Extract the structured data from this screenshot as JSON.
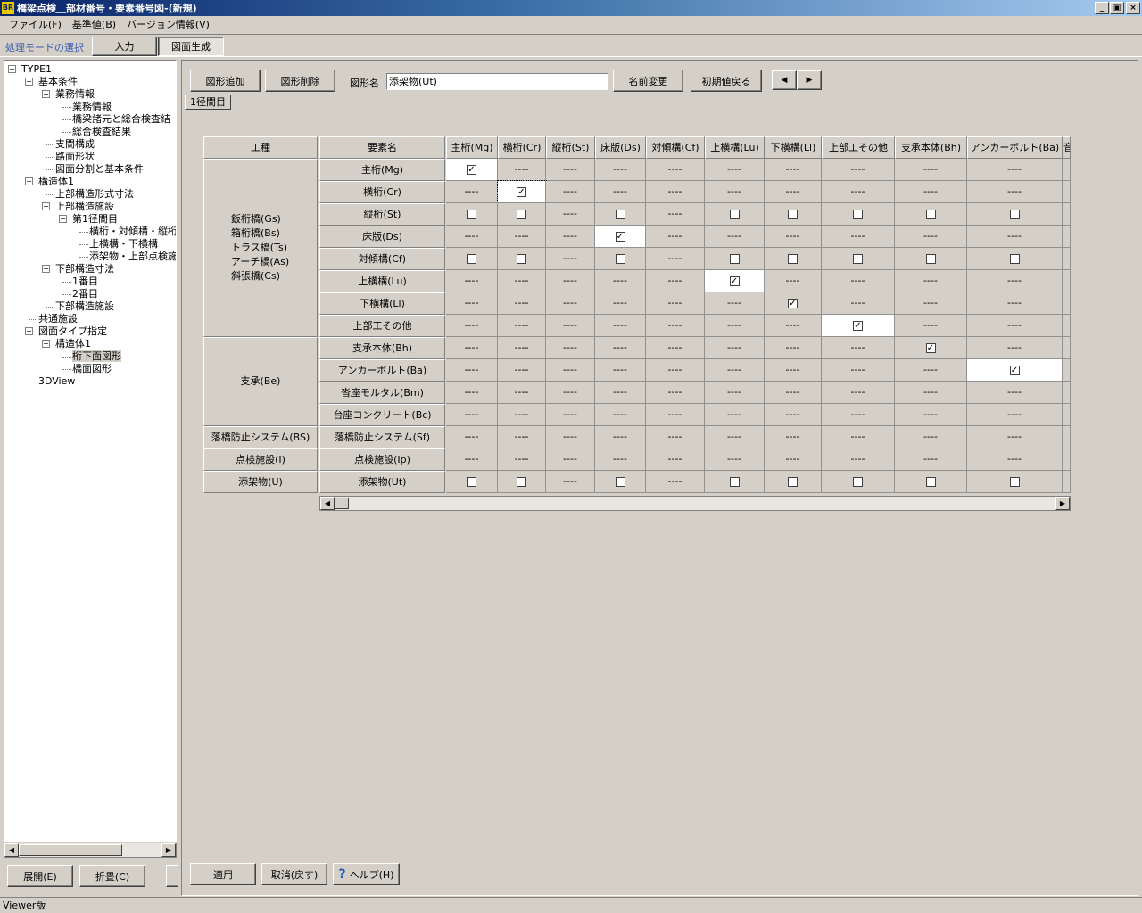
{
  "window": {
    "app_icon": "BR",
    "title": "橋梁点検＿部材番号・要素番号図-(新規)",
    "minimize": "_",
    "maximize": "▣",
    "close": "×"
  },
  "menu": [
    "ファイル(F)",
    "基準値(B)",
    "バージョン情報(V)"
  ],
  "mode": {
    "label": "処理モードの選択",
    "input_label": "入力",
    "generate_label": "図面生成",
    "active": "generate"
  },
  "tree": {
    "items": [
      {
        "label": "TYPE1",
        "level": 0,
        "box": "-"
      },
      {
        "label": "基本条件",
        "level": 1,
        "box": "-"
      },
      {
        "label": "業務情報",
        "level": 2,
        "box": "-"
      },
      {
        "label": "業務情報",
        "level": 3,
        "box": ""
      },
      {
        "label": "橋梁諸元と総合検査結",
        "level": 3,
        "box": ""
      },
      {
        "label": "総合検査結果",
        "level": 3,
        "box": ""
      },
      {
        "label": "支間構成",
        "level": 2,
        "box": ""
      },
      {
        "label": "路面形状",
        "level": 2,
        "box": ""
      },
      {
        "label": "図面分割と基本条件",
        "level": 2,
        "box": ""
      },
      {
        "label": "構造体1",
        "level": 1,
        "box": "-"
      },
      {
        "label": "上部構造形式寸法",
        "level": 2,
        "box": ""
      },
      {
        "label": "上部構造施設",
        "level": 2,
        "box": "-"
      },
      {
        "label": "第1径間目",
        "level": 3,
        "box": "-"
      },
      {
        "label": "横桁・対傾構・縦桁",
        "level": 4,
        "box": ""
      },
      {
        "label": "上横構・下横構",
        "level": 4,
        "box": ""
      },
      {
        "label": "添架物・上部点検施",
        "level": 4,
        "box": ""
      },
      {
        "label": "下部構造寸法",
        "level": 2,
        "box": "-"
      },
      {
        "label": "1番目",
        "level": 3,
        "box": ""
      },
      {
        "label": "2番目",
        "level": 3,
        "box": ""
      },
      {
        "label": "下部構造施設",
        "level": 2,
        "box": ""
      },
      {
        "label": "共通施設",
        "level": 1,
        "box": ""
      },
      {
        "label": "図面タイプ指定",
        "level": 1,
        "box": "-"
      },
      {
        "label": "構造体1",
        "level": 2,
        "box": "-"
      },
      {
        "label": "桁下面図形",
        "level": 3,
        "box": "",
        "selected": true
      },
      {
        "label": "橋面図形",
        "level": 3,
        "box": ""
      },
      {
        "label": "3DView",
        "level": 1,
        "box": ""
      }
    ],
    "expand_label": "展開(E)",
    "collapse_label": "折畳(C)"
  },
  "toolbar": {
    "add_label": "図形追加",
    "delete_label": "図形削除",
    "name_caption": "図形名",
    "name_value": "添架物(Ut)",
    "rename_label": "名前変更",
    "reset_label": "初期値戻る",
    "prev": "◀",
    "next": "▶",
    "span_label": "1径間目"
  },
  "grid": {
    "type_header": "工種",
    "elem_header": "要素名",
    "columns": [
      "主桁(Mg)",
      "横桁(Cr)",
      "縦桁(St)",
      "床版(Ds)",
      "対傾構(Cf)",
      "上横構(Lu)",
      "下横構(Ll)",
      "上部工その他",
      "支承本体(Bh)",
      "アンカーボルト(Ba)",
      "音"
    ],
    "type_groups": [
      {
        "lines": [
          "鈑桁橋(Gs)",
          "箱桁橋(Bs)",
          "トラス橋(Ts)",
          "アーチ橋(As)",
          "斜張橋(Cs)"
        ]
      },
      {
        "lines": [
          "支承(Be)"
        ]
      },
      {
        "lines": [
          "落橋防止システム(BS)"
        ]
      },
      {
        "lines": [
          "点検施設(I)"
        ]
      },
      {
        "lines": [
          "添架物(U)"
        ]
      }
    ],
    "dash": "----",
    "check": "✓",
    "rows": [
      {
        "name": "主桁(Mg)",
        "cells": [
          "X",
          "-",
          "-",
          "-",
          "-",
          "-",
          "-",
          "-",
          "-",
          "-"
        ]
      },
      {
        "name": "横桁(Cr)",
        "cells": [
          "-",
          "X",
          "-",
          "-",
          "-",
          "-",
          "-",
          "-",
          "-",
          "-"
        ]
      },
      {
        "name": "縦桁(St)",
        "cells": [
          "O",
          "O",
          "-",
          "O",
          "-",
          "O",
          "O",
          "O",
          "O",
          "O"
        ]
      },
      {
        "name": "床版(Ds)",
        "cells": [
          "-",
          "-",
          "-",
          "X",
          "-",
          "-",
          "-",
          "-",
          "-",
          "-"
        ]
      },
      {
        "name": "対傾構(Cf)",
        "cells": [
          "O",
          "O",
          "-",
          "O",
          "-",
          "O",
          "O",
          "O",
          "O",
          "O"
        ]
      },
      {
        "name": "上横構(Lu)",
        "cells": [
          "-",
          "-",
          "-",
          "-",
          "-",
          "X",
          "-",
          "-",
          "-",
          "-"
        ]
      },
      {
        "name": "下横構(Ll)",
        "cells": [
          "-",
          "-",
          "-",
          "-",
          "-",
          "-",
          "x",
          "-",
          "-",
          "-"
        ]
      },
      {
        "name": "上部工その他",
        "cells": [
          "-",
          "-",
          "-",
          "-",
          "-",
          "-",
          "-",
          "X",
          "-",
          "-"
        ]
      },
      {
        "name": "支承本体(Bh)",
        "cells": [
          "-",
          "-",
          "-",
          "-",
          "-",
          "-",
          "-",
          "-",
          "x",
          "-"
        ]
      },
      {
        "name": "アンカーボルト(Ba)",
        "cells": [
          "-",
          "-",
          "-",
          "-",
          "-",
          "-",
          "-",
          "-",
          "-",
          "X"
        ]
      },
      {
        "name": "沓座モルタル(Bm)",
        "cells": [
          "-",
          "-",
          "-",
          "-",
          "-",
          "-",
          "-",
          "-",
          "-",
          "-"
        ]
      },
      {
        "name": "台座コンクリート(Bc)",
        "cells": [
          "-",
          "-",
          "-",
          "-",
          "-",
          "-",
          "-",
          "-",
          "-",
          "-"
        ]
      },
      {
        "name": "落橋防止システム(Sf)",
        "cells": [
          "-",
          "-",
          "-",
          "-",
          "-",
          "-",
          "-",
          "-",
          "-",
          "-"
        ]
      },
      {
        "name": "点検施設(Ip)",
        "cells": [
          "-",
          "-",
          "-",
          "-",
          "-",
          "-",
          "-",
          "-",
          "-",
          "-"
        ]
      },
      {
        "name": "添架物(Ut)",
        "cells": [
          "O",
          "O",
          "-",
          "O",
          "-",
          "O",
          "O",
          "O",
          "O",
          "O"
        ]
      }
    ]
  },
  "footer": {
    "apply_label": "適用",
    "cancel_label": "取消(戻す)",
    "help_label": "ヘルプ(H)",
    "help_icon": "?"
  },
  "status": "Viewer版"
}
